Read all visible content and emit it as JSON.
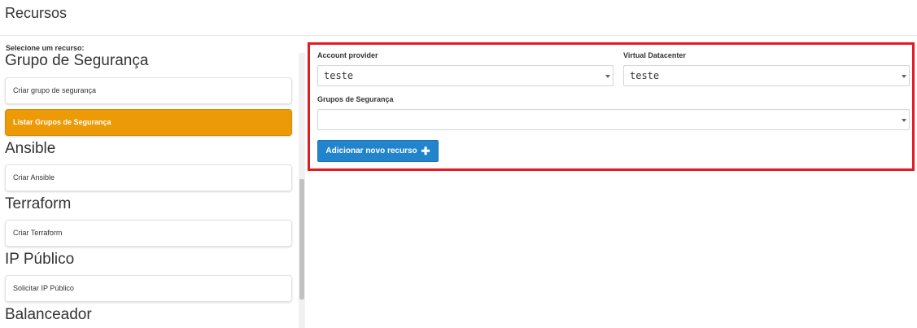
{
  "page": {
    "title": "Recursos"
  },
  "sidebar": {
    "select_label": "Selecione um recurso:",
    "groups": [
      {
        "title": "Grupo de Segurança",
        "items": [
          "Criar grupo de segurança",
          "Listar Grupos de Segurança"
        ]
      },
      {
        "title": "Ansible",
        "items": [
          "Criar Ansible"
        ]
      },
      {
        "title": "Terraform",
        "items": [
          "Criar Terraform"
        ]
      },
      {
        "title": "IP Público",
        "items": [
          "Solicitar IP Público"
        ]
      },
      {
        "title": "Balanceador"
      }
    ],
    "active_item": "Listar Grupos de Segurança",
    "active_color": "#ec9a05"
  },
  "form": {
    "account_provider": {
      "label": "Account provider",
      "value": "teste"
    },
    "virtual_datacenter": {
      "label": "Virtual Datacenter",
      "value": "teste"
    },
    "security_groups": {
      "label": "Grupos de Segurança",
      "value": ""
    },
    "add_button": {
      "label": "Adicionar novo recurso",
      "icon": "plus-icon",
      "color": "#2184cc"
    },
    "highlight_color": "#e01b24"
  }
}
